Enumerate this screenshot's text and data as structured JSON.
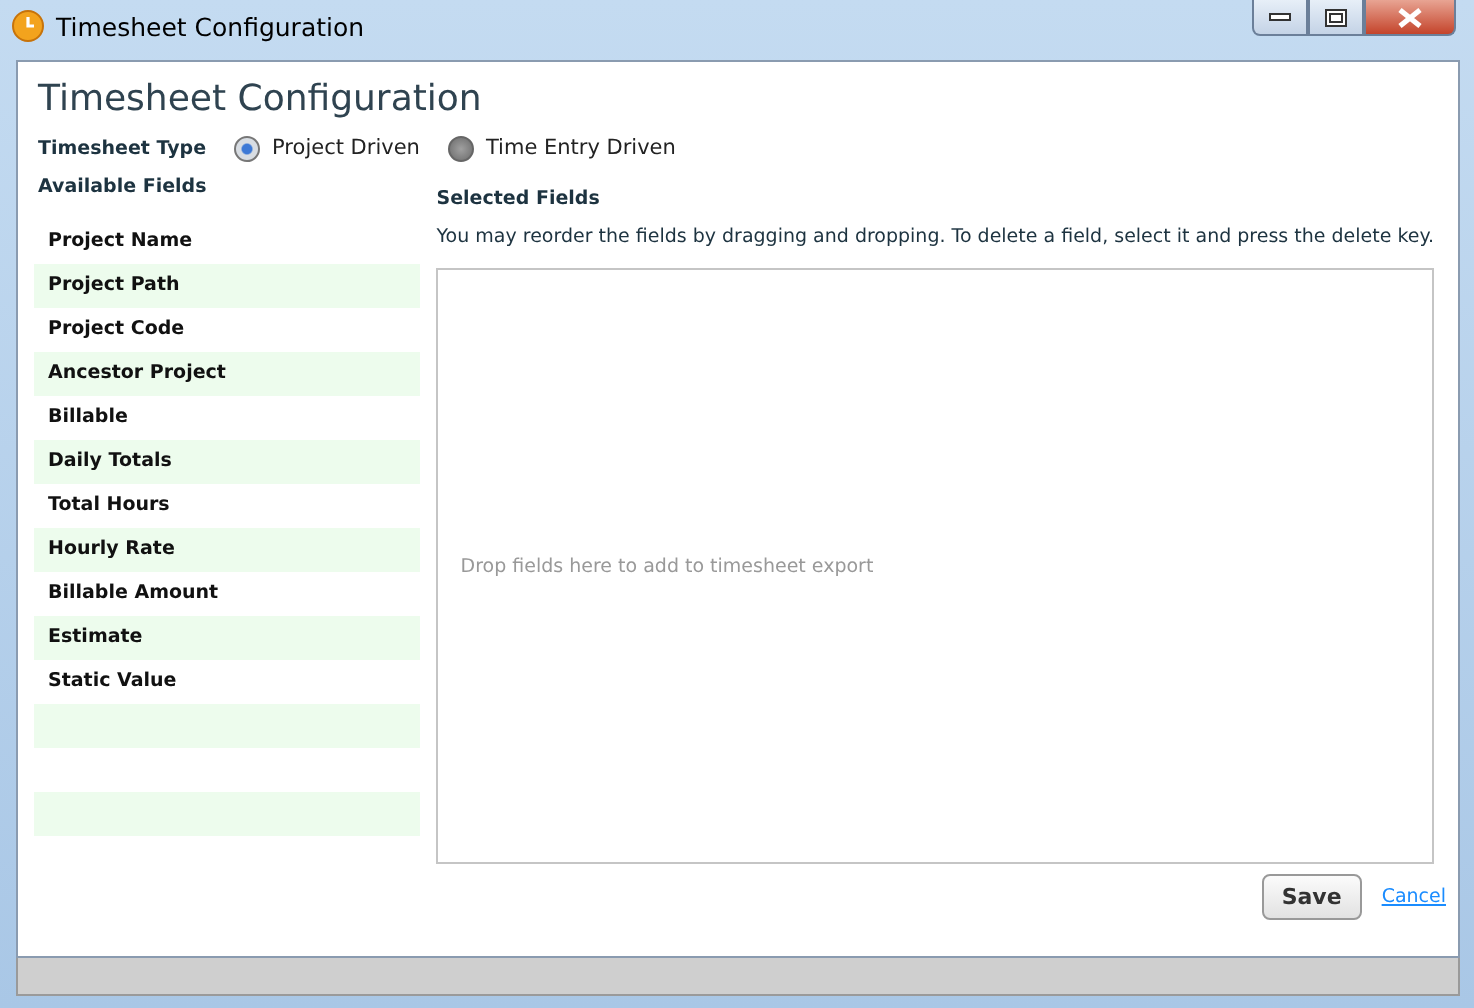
{
  "window": {
    "title": "Timesheet Configuration"
  },
  "heading": "Timesheet Configuration",
  "timesheet_type": {
    "label": "Timesheet Type",
    "options": [
      {
        "label": "Project Driven",
        "selected": true
      },
      {
        "label": "Time Entry Driven",
        "selected": false
      }
    ]
  },
  "available_fields": {
    "title": "Available Fields",
    "items": [
      "Project Name",
      "Project Path",
      "Project Code",
      "Ancestor Project",
      "Billable",
      "Daily Totals",
      "Total Hours",
      "Hourly Rate",
      "Billable Amount",
      "Estimate",
      "Static Value"
    ]
  },
  "selected_fields": {
    "title": "Selected Fields",
    "hint": "You may reorder the fields by dragging and dropping. To delete a field, select it and press the delete key.",
    "placeholder": "Drop fields here to add to timesheet export"
  },
  "buttons": {
    "save": "Save",
    "cancel": "Cancel"
  }
}
